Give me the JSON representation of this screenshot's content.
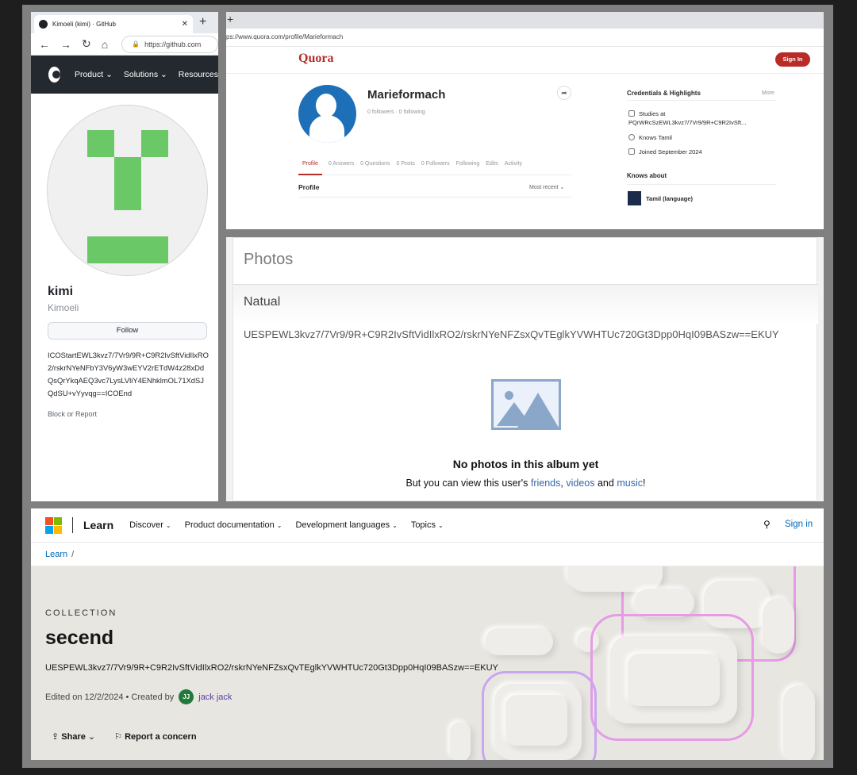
{
  "github": {
    "tab_title": "Kimoeli (kimi) · GitHub",
    "url": "https://github.com",
    "nav": [
      "Product",
      "Solutions",
      "Resources"
    ],
    "name": "kimi",
    "login": "Kimoeli",
    "follow_label": "Follow",
    "bio": "ICOStartEWL3kvz7/7Vr9/9R+C9R2IvSftVidIlxRO2/rskrNYeNFbY3V6yW3wEYV2rETdW4z28xDdQsQrYkqAEQ3vc7LysLVliY4ENhklmOL71XdSJQdSU+vYyvqg==ICOEnd",
    "block_label": "Block or Report",
    "avatar_color": "#6ac867"
  },
  "quora": {
    "new_tab": "+",
    "url": "ps://www.quora.com/profile/Marieformach",
    "brand": "Quora",
    "signin": "Sign In",
    "name": "Marieformach",
    "stats": "0 followers · 0 following",
    "tabs": [
      "Profile",
      "0 Answers",
      "0 Questions",
      "0 Posts",
      "0 Followers",
      "Following",
      "Edits",
      "Activity"
    ],
    "section_title": "Profile",
    "sort_label": "Most recent",
    "credentials_title": "Credentials & Highlights",
    "more_label": "More",
    "cred_studies_1": "Studies at",
    "cred_studies_2": "PQrWRcSzEWL3kvz7/7Vr9/9R+C9R2IvSft...",
    "cred_knows": "Knows Tamil",
    "cred_joined": "Joined September 2024",
    "knows_about_title": "Knows about",
    "topic": "Tamil (language)",
    "brand_color": "#b92b27"
  },
  "photos": {
    "title": "Photos",
    "album": "Natual",
    "description": "UESPEWL3kvz7/7Vr9/9R+C9R2IvSftVidIlxRO2/rskrNYeNFZsxQvTEglkYVWHTUc720Gt3Dpp0HqI09BASzw==EKUY",
    "empty_title": "No photos in this album yet",
    "sub_prefix": "But you can view this user's",
    "link_friends": "friends",
    "sep1": ",",
    "link_videos": "videos",
    "sep2": "and",
    "link_music": "music",
    "sub_suffix": "!"
  },
  "mslearn": {
    "brand": "Learn",
    "menu": [
      "Discover",
      "Product documentation",
      "Development languages",
      "Topics"
    ],
    "signin": "Sign in",
    "breadcrumb": "Learn",
    "breadcrumb_sep": "/",
    "kicker": "COLLECTION",
    "title": "secend",
    "description": "UESPEWL3kvz7/7Vr9/9R+C9R2IvSftVidIlxRO2/rskrNYeNFZsxQvTEglkYVWHTUc720Gt3Dpp0HqI09BASzw==EKUY",
    "edited": "Edited on 12/2/2024 • Created by",
    "author_initials": "JJ",
    "author": "jack jack",
    "share": "Share",
    "report": "Report a concern",
    "logo_colors": [
      "#f25022",
      "#7fba00",
      "#00a4ef",
      "#ffb900"
    ]
  }
}
